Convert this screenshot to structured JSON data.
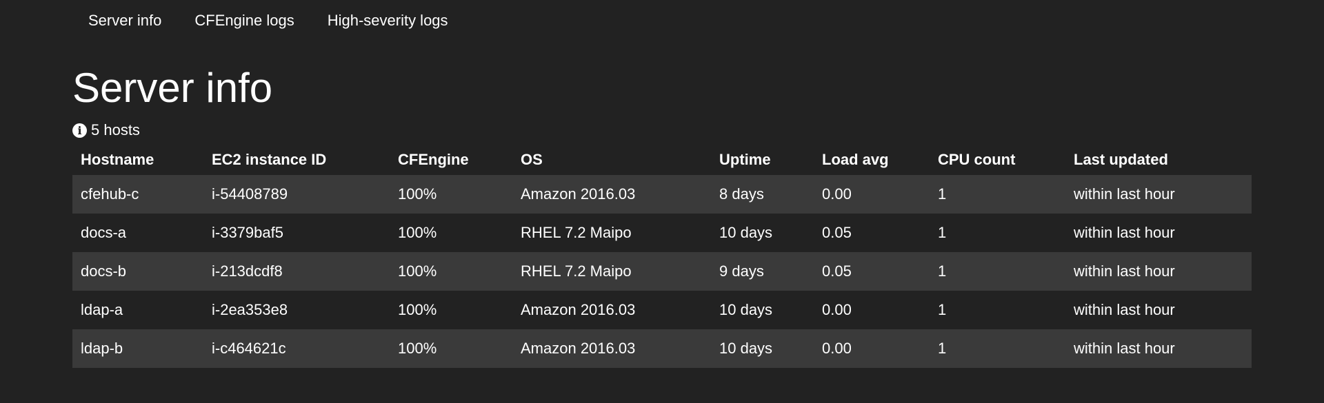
{
  "nav": {
    "items": [
      {
        "label": "Server info"
      },
      {
        "label": "CFEngine logs"
      },
      {
        "label": "High-severity logs"
      }
    ]
  },
  "page": {
    "title": "Server info",
    "host_count_text": "5 hosts",
    "icon": "info-circle-icon"
  },
  "table": {
    "headers": [
      "Hostname",
      "EC2 instance ID",
      "CFEngine",
      "OS",
      "Uptime",
      "Load avg",
      "CPU count",
      "Last updated"
    ],
    "rows": [
      [
        "cfehub-c",
        "i-54408789",
        "100%",
        "Amazon 2016.03",
        "8 days",
        "0.00",
        "1",
        "within last hour"
      ],
      [
        "docs-a",
        "i-3379baf5",
        "100%",
        "RHEL 7.2 Maipo",
        "10 days",
        "0.05",
        "1",
        "within last hour"
      ],
      [
        "docs-b",
        "i-213dcdf8",
        "100%",
        "RHEL 7.2 Maipo",
        "9 days",
        "0.05",
        "1",
        "within last hour"
      ],
      [
        "ldap-a",
        "i-2ea353e8",
        "100%",
        "Amazon 2016.03",
        "10 days",
        "0.00",
        "1",
        "within last hour"
      ],
      [
        "ldap-b",
        "i-c464621c",
        "100%",
        "Amazon 2016.03",
        "10 days",
        "0.00",
        "1",
        "within last hour"
      ]
    ]
  }
}
